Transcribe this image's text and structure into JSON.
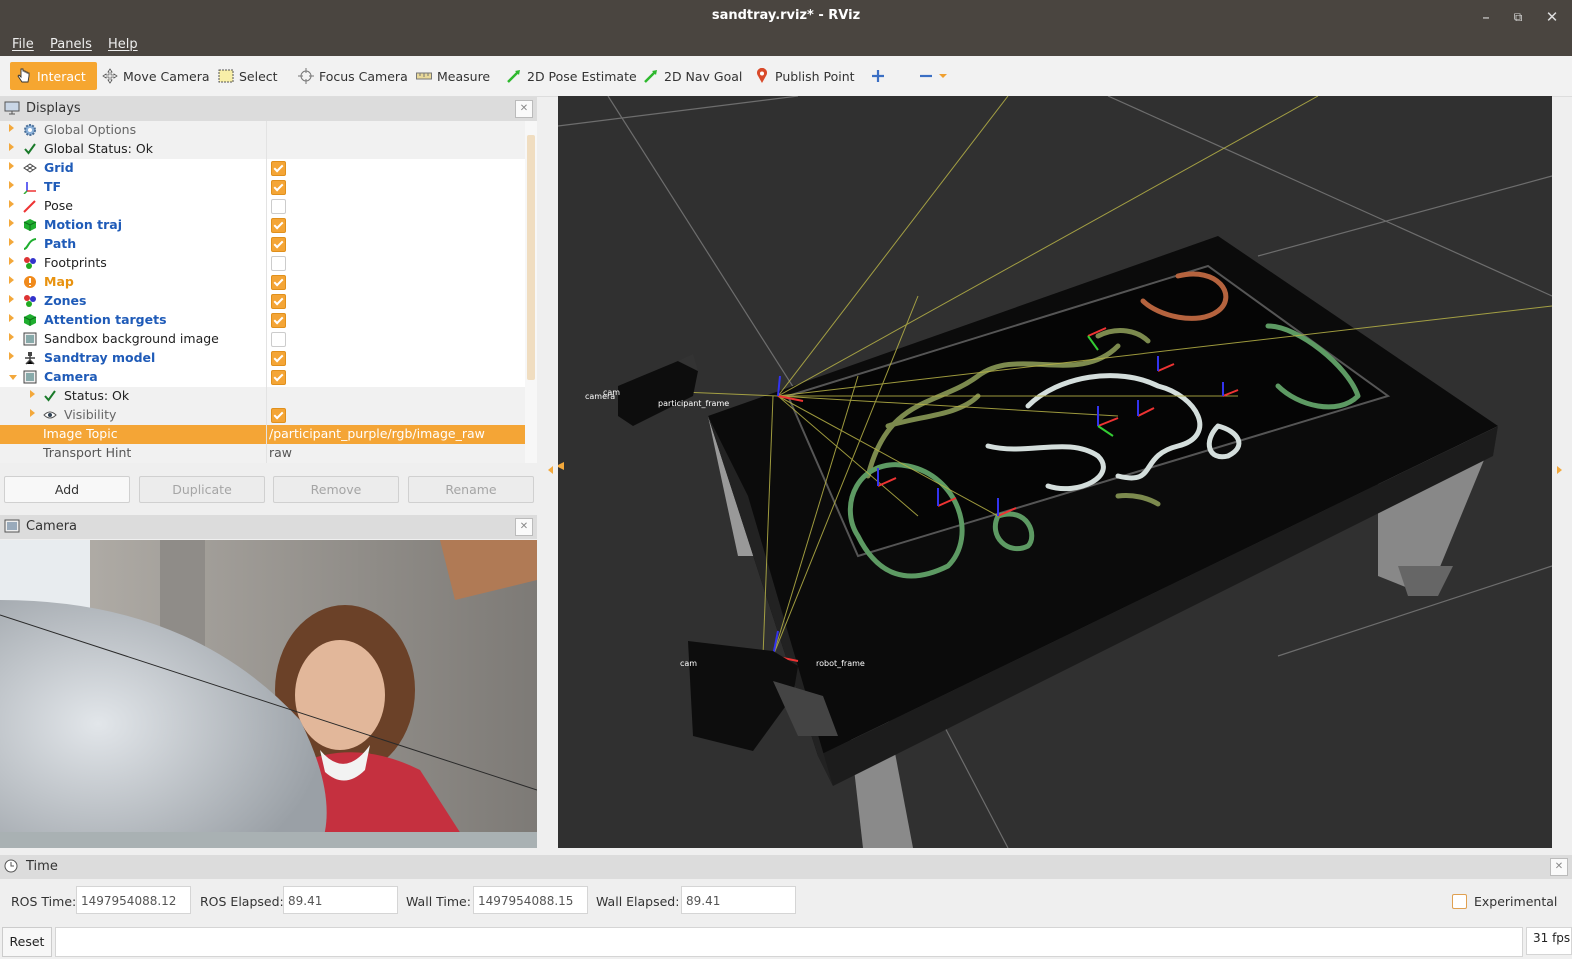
{
  "window": {
    "title": "sandtray.rviz* - RViz"
  },
  "menu": {
    "file": "File",
    "panels": "Panels",
    "help": "Help"
  },
  "toolbar": {
    "interact": "Interact",
    "move_camera": "Move Camera",
    "select": "Select",
    "focus_camera": "Focus Camera",
    "measure": "Measure",
    "pose_estimate": "2D Pose Estimate",
    "nav_goal": "2D Nav Goal",
    "publish_point": "Publish Point"
  },
  "displays": {
    "title": "Displays",
    "rows": [
      {
        "label": "Global Options",
        "style": "gray",
        "icon": "gear-icon"
      },
      {
        "label": "Global Status: Ok",
        "style": "normal",
        "icon": "check-icon"
      },
      {
        "label": "Grid",
        "style": "blue",
        "checked": true,
        "icon": "grid-icon"
      },
      {
        "label": "TF",
        "style": "blue",
        "checked": true,
        "icon": "axes-icon"
      },
      {
        "label": "Pose",
        "style": "normal",
        "checked": false,
        "icon": "pose-arrow-icon"
      },
      {
        "label": "Motion traj",
        "style": "blue",
        "checked": true,
        "icon": "cube-icon"
      },
      {
        "label": "Path",
        "style": "blue",
        "checked": true,
        "icon": "path-icon"
      },
      {
        "label": "Footprints",
        "style": "normal",
        "checked": false,
        "icon": "markers-icon"
      },
      {
        "label": "Map",
        "style": "orange",
        "checked": true,
        "icon": "warning-icon"
      },
      {
        "label": "Zones",
        "style": "blue",
        "checked": true,
        "icon": "markers-icon"
      },
      {
        "label": "Attention targets",
        "style": "blue",
        "checked": true,
        "icon": "cube-icon"
      },
      {
        "label": "Sandbox background image",
        "style": "normal",
        "checked": false,
        "icon": "image-icon"
      },
      {
        "label": "Sandtray model",
        "style": "blue",
        "checked": true,
        "icon": "robot-model-icon"
      },
      {
        "label": "Camera",
        "style": "blue",
        "checked": true,
        "icon": "image-icon"
      },
      {
        "label": "Status: Ok",
        "style": "normal",
        "icon": "check-icon"
      },
      {
        "label": "Visibility",
        "style": "gray",
        "checked": true,
        "icon": "eye-icon"
      },
      {
        "label": "Image Topic",
        "value": "/participant_purple/rgb/image_raw"
      },
      {
        "label": "Transport Hint",
        "value": "raw"
      }
    ],
    "buttons": {
      "add": "Add",
      "duplicate": "Duplicate",
      "remove": "Remove",
      "rename": "Rename"
    }
  },
  "camera_panel": {
    "title": "Camera"
  },
  "viewport_labels": {
    "left_cam_a": "cam",
    "left_cam_b": "camera",
    "left_frames": "participant_frame",
    "bottom_cam": "cam",
    "bottom_frames": "robot_frame"
  },
  "time": {
    "title": "Time",
    "ros_time_label": "ROS Time:",
    "ros_time": "1497954088.12",
    "ros_elapsed_label": "ROS Elapsed:",
    "ros_elapsed": "89.41",
    "wall_time_label": "Wall Time:",
    "wall_time": "1497954088.15",
    "wall_elapsed_label": "Wall Elapsed:",
    "wall_elapsed": "89.41",
    "experimental": "Experimental"
  },
  "status": {
    "reset": "Reset",
    "fps": "31 fps"
  },
  "colors": {
    "accent": "#f4a536",
    "blue_label": "#1f5bb8",
    "orange_label": "#e8920f"
  }
}
